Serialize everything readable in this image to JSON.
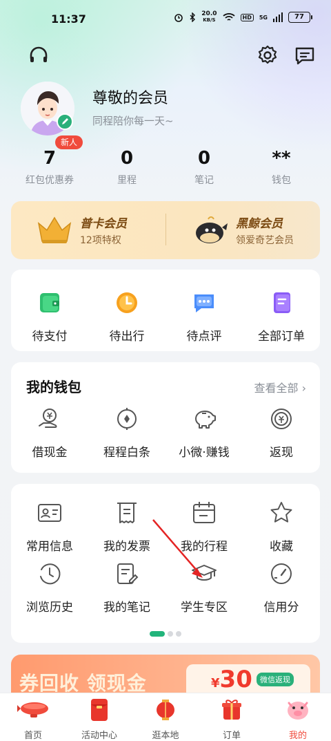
{
  "status": {
    "time": "11:37",
    "net_speed_top": "20.0",
    "net_speed_unit": "KB/S",
    "hd": "HD",
    "signal": "5G",
    "battery": "77"
  },
  "profile": {
    "name": "尊敬的会员",
    "slogan": "同程陪你每一天~",
    "badge": "新人"
  },
  "stats": [
    {
      "value": "7",
      "label": "红包优惠券"
    },
    {
      "value": "0",
      "label": "里程"
    },
    {
      "value": "0",
      "label": "笔记"
    },
    {
      "value": "**",
      "label": "钱包"
    }
  ],
  "membership": [
    {
      "title": "普卡会员",
      "subtitle": "12项特权"
    },
    {
      "title": "黑鲸会员",
      "subtitle": "领爱奇艺会员"
    }
  ],
  "orders": [
    {
      "label": "待支付",
      "icon": "wallet-icon"
    },
    {
      "label": "待出行",
      "icon": "clock-icon"
    },
    {
      "label": "待点评",
      "icon": "chat-icon"
    },
    {
      "label": "全部订单",
      "icon": "document-icon"
    }
  ],
  "wallet": {
    "title": "我的钱包",
    "see_all": "查看全部",
    "items": [
      {
        "label": "借现金",
        "icon": "yuan-hand-icon"
      },
      {
        "label": "程程白条",
        "icon": "compass-icon"
      },
      {
        "label": "小微·赚钱",
        "icon": "piggy-bank-icon"
      },
      {
        "label": "返现",
        "icon": "cashback-icon"
      }
    ]
  },
  "services": [
    {
      "label": "常用信息",
      "icon": "id-card-icon"
    },
    {
      "label": "我的发票",
      "icon": "invoice-icon"
    },
    {
      "label": "我的行程",
      "icon": "calendar-icon"
    },
    {
      "label": "收藏",
      "icon": "star-icon"
    },
    {
      "label": "浏览历史",
      "icon": "history-icon"
    },
    {
      "label": "我的笔记",
      "icon": "note-edit-icon"
    },
    {
      "label": "学生专区",
      "icon": "graduation-cap-icon"
    },
    {
      "label": "信用分",
      "icon": "gauge-icon"
    }
  ],
  "banner": {
    "text": "券回收 领现金",
    "price_symbol": "¥",
    "price": "30",
    "tag": "微信返现"
  },
  "tabs": [
    {
      "label": "首页",
      "icon": "airship-icon"
    },
    {
      "label": "活动中心",
      "icon": "red-envelope-icon"
    },
    {
      "label": "逛本地",
      "icon": "lantern-icon"
    },
    {
      "label": "订单",
      "icon": "gift-icon"
    },
    {
      "label": "我的",
      "icon": "pig-icon",
      "active": true
    }
  ],
  "colors": {
    "accent": "#22b47b",
    "badge": "#f04b3c",
    "member_bg": "#fde8c3"
  }
}
